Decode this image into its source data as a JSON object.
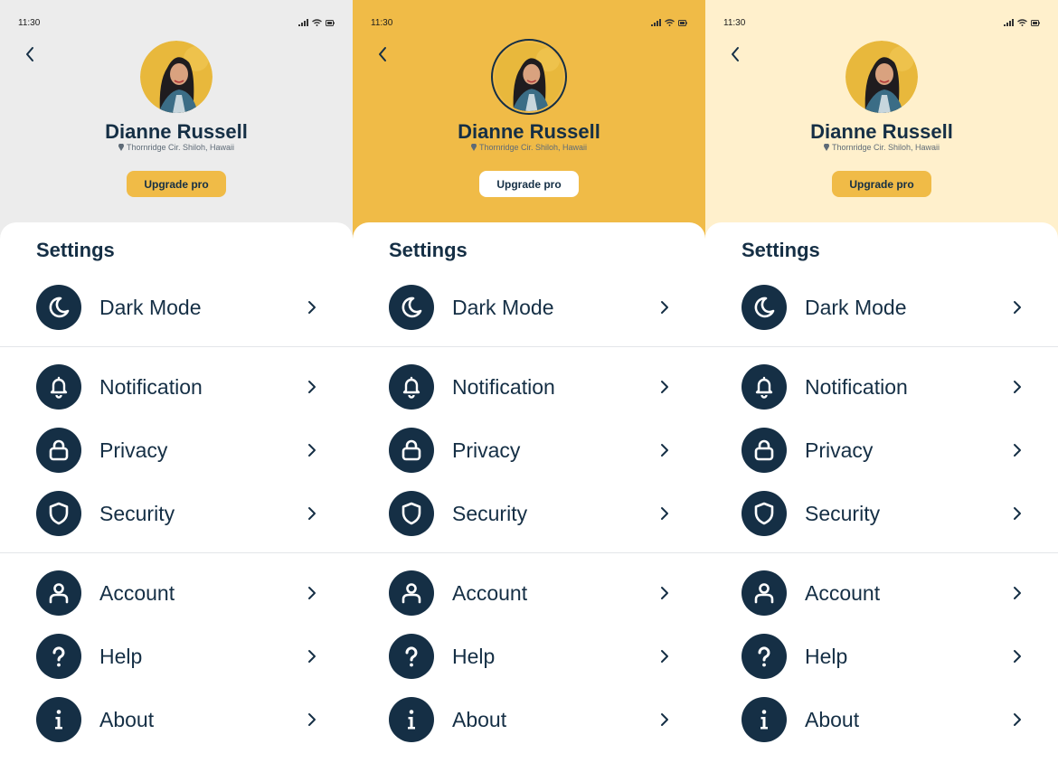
{
  "screens": [
    {
      "variant": "grey",
      "header_bg": "#ececec",
      "button_bg": "#f0bb47",
      "avatar_ring": false
    },
    {
      "variant": "yellow",
      "header_bg": "#f0bb47",
      "button_bg": "#ffffff",
      "avatar_ring": true
    },
    {
      "variant": "cream",
      "header_bg": "#fff0cc",
      "button_bg": "#f0bb47",
      "avatar_ring": false
    }
  ],
  "status_bar": {
    "time": "11:30"
  },
  "profile": {
    "name": "Dianne Russell",
    "location": "Thornridge Cir. Shiloh, Hawaii",
    "upgrade_label": "Upgrade pro"
  },
  "settings": {
    "title": "Settings",
    "items": [
      {
        "label": "Dark Mode",
        "icon": "moon-icon"
      },
      {
        "label": "Notification",
        "icon": "bell-icon"
      },
      {
        "label": "Privacy",
        "icon": "lock-icon"
      },
      {
        "label": "Security",
        "icon": "shield-icon"
      },
      {
        "label": "Account",
        "icon": "user-icon"
      },
      {
        "label": "Help",
        "icon": "help-icon"
      },
      {
        "label": "About",
        "icon": "info-icon"
      }
    ]
  },
  "colors": {
    "primary": "#152f45",
    "accent": "#f0bb47",
    "divider": "#e3e6e9"
  }
}
